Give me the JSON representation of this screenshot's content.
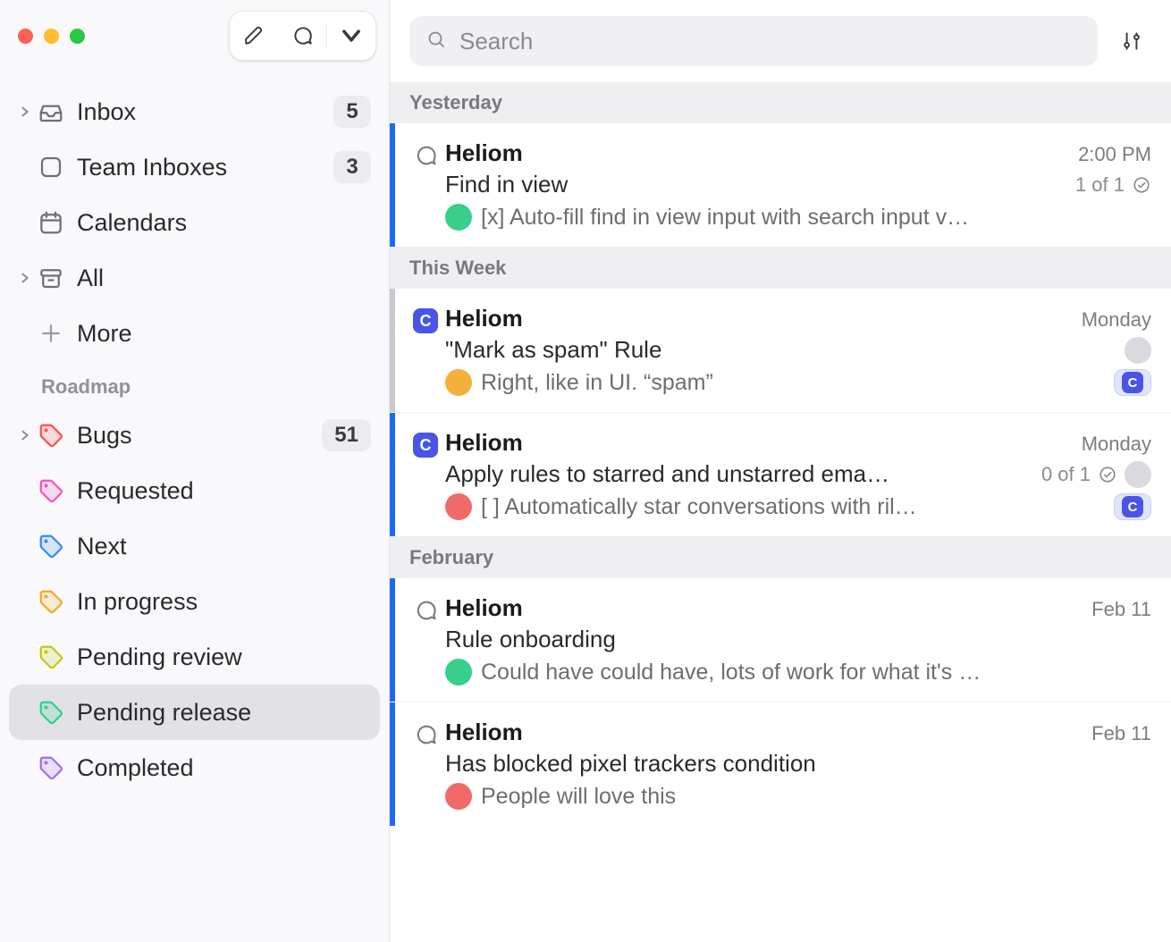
{
  "search": {
    "placeholder": "Search"
  },
  "sidebar": {
    "items": [
      {
        "label": "Inbox",
        "count": "5"
      },
      {
        "label": "Team Inboxes",
        "count": "3"
      },
      {
        "label": "Calendars",
        "count": ""
      },
      {
        "label": "All",
        "count": ""
      },
      {
        "label": "More",
        "count": ""
      }
    ],
    "section": "Roadmap",
    "roadmap": [
      {
        "label": "Bugs",
        "count": "51"
      },
      {
        "label": "Requested",
        "count": ""
      },
      {
        "label": "Next",
        "count": ""
      },
      {
        "label": "In progress",
        "count": ""
      },
      {
        "label": "Pending review",
        "count": ""
      },
      {
        "label": "Pending release",
        "count": ""
      },
      {
        "label": "Completed",
        "count": ""
      }
    ]
  },
  "groups": [
    {
      "title": "Yesterday",
      "messages": [
        {
          "from": "Heliom",
          "time": "2:00 PM",
          "subject": "Find in view",
          "progress": "1 of 1",
          "preview": "[x] Auto-fill find in view input with search input v…",
          "leading": "chat",
          "stripe": "blue",
          "avatar_color": "#38cf8a"
        }
      ]
    },
    {
      "title": "This Week",
      "messages": [
        {
          "from": "Heliom",
          "time": "Monday",
          "subject": "\"Mark as spam\" Rule",
          "progress": "",
          "preview": "Right, like in UI. “spam”",
          "leading": "c",
          "stripe": "gray",
          "avatar_color": "#f3b03b",
          "trailing_avatar": true,
          "trailing_c_pill": true
        },
        {
          "from": "Heliom",
          "time": "Monday",
          "subject": "Apply rules to starred and unstarred ema…",
          "progress": "0 of 1",
          "preview": "[ ] Automatically star conversations with ril…",
          "leading": "c",
          "stripe": "blue",
          "avatar_color": "#f16a6a",
          "row2_avatar": true,
          "trailing_c_pill": true
        }
      ]
    },
    {
      "title": "February",
      "messages": [
        {
          "from": "Heliom",
          "time": "Feb 11",
          "subject": "Rule onboarding",
          "progress": "",
          "preview": "Could have could have, lots of work for what it's …",
          "leading": "chat",
          "stripe": "blue",
          "avatar_color": "#38cf8a"
        },
        {
          "from": "Heliom",
          "time": "Feb 11",
          "subject": "Has blocked pixel trackers condition",
          "progress": "",
          "preview": "People will love this",
          "leading": "chat",
          "stripe": "blue",
          "avatar_color": "#f16a6a"
        }
      ]
    }
  ]
}
